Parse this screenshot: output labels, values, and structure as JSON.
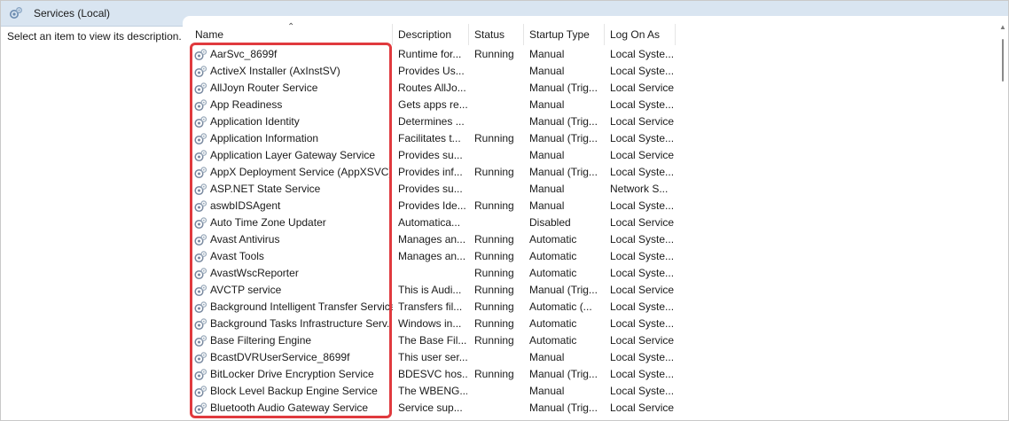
{
  "window": {
    "title": "Services (Local)",
    "icon": "services-gear-icon"
  },
  "left_panel": {
    "description": "Select an item to view its description."
  },
  "columns": [
    {
      "key": "name",
      "label": "Name",
      "sorted": "ascending"
    },
    {
      "key": "description",
      "label": "Description"
    },
    {
      "key": "status",
      "label": "Status"
    },
    {
      "key": "startup",
      "label": "Startup Type"
    },
    {
      "key": "logon",
      "label": "Log On As"
    }
  ],
  "services": [
    {
      "name": "AarSvc_8699f",
      "description": "Runtime for...",
      "status": "Running",
      "startup": "Manual",
      "logon": "Local Syste..."
    },
    {
      "name": "ActiveX Installer (AxInstSV)",
      "description": "Provides Us...",
      "status": "",
      "startup": "Manual",
      "logon": "Local Syste..."
    },
    {
      "name": "AllJoyn Router Service",
      "description": "Routes AllJo...",
      "status": "",
      "startup": "Manual (Trig...",
      "logon": "Local Service"
    },
    {
      "name": "App Readiness",
      "description": "Gets apps re...",
      "status": "",
      "startup": "Manual",
      "logon": "Local Syste..."
    },
    {
      "name": "Application Identity",
      "description": "Determines ...",
      "status": "",
      "startup": "Manual (Trig...",
      "logon": "Local Service"
    },
    {
      "name": "Application Information",
      "description": "Facilitates t...",
      "status": "Running",
      "startup": "Manual (Trig...",
      "logon": "Local Syste..."
    },
    {
      "name": "Application Layer Gateway Service",
      "description": "Provides su...",
      "status": "",
      "startup": "Manual",
      "logon": "Local Service"
    },
    {
      "name": "AppX Deployment Service (AppXSVC)",
      "description": "Provides inf...",
      "status": "Running",
      "startup": "Manual (Trig...",
      "logon": "Local Syste..."
    },
    {
      "name": "ASP.NET State Service",
      "description": "Provides su...",
      "status": "",
      "startup": "Manual",
      "logon": "Network S..."
    },
    {
      "name": "aswbIDSAgent",
      "description": "Provides Ide...",
      "status": "Running",
      "startup": "Manual",
      "logon": "Local Syste..."
    },
    {
      "name": "Auto Time Zone Updater",
      "description": "Automatica...",
      "status": "",
      "startup": "Disabled",
      "logon": "Local Service"
    },
    {
      "name": "Avast Antivirus",
      "description": "Manages an...",
      "status": "Running",
      "startup": "Automatic",
      "logon": "Local Syste..."
    },
    {
      "name": "Avast Tools",
      "description": "Manages an...",
      "status": "Running",
      "startup": "Automatic",
      "logon": "Local Syste..."
    },
    {
      "name": "AvastWscReporter",
      "description": "",
      "status": "Running",
      "startup": "Automatic",
      "logon": "Local Syste..."
    },
    {
      "name": "AVCTP service",
      "description": "This is Audi...",
      "status": "Running",
      "startup": "Manual (Trig...",
      "logon": "Local Service"
    },
    {
      "name": "Background Intelligent Transfer Service",
      "description": "Transfers fil...",
      "status": "Running",
      "startup": "Automatic (...",
      "logon": "Local Syste..."
    },
    {
      "name": "Background Tasks Infrastructure Serv...",
      "description": "Windows in...",
      "status": "Running",
      "startup": "Automatic",
      "logon": "Local Syste..."
    },
    {
      "name": "Base Filtering Engine",
      "description": "The Base Fil...",
      "status": "Running",
      "startup": "Automatic",
      "logon": "Local Service"
    },
    {
      "name": "BcastDVRUserService_8699f",
      "description": "This user ser...",
      "status": "",
      "startup": "Manual",
      "logon": "Local Syste..."
    },
    {
      "name": "BitLocker Drive Encryption Service",
      "description": "BDESVC hos...",
      "status": "Running",
      "startup": "Manual (Trig...",
      "logon": "Local Syste..."
    },
    {
      "name": "Block Level Backup Engine Service",
      "description": "The WBENG...",
      "status": "",
      "startup": "Manual",
      "logon": "Local Syste..."
    },
    {
      "name": "Bluetooth Audio Gateway Service",
      "description": "Service sup...",
      "status": "",
      "startup": "Manual (Trig...",
      "logon": "Local Service"
    }
  ],
  "annotation": {
    "color": "#e03a3e",
    "target": "name-column"
  },
  "colors": {
    "header_bar": "#d9e5f1",
    "highlight": "#e03a3e"
  }
}
